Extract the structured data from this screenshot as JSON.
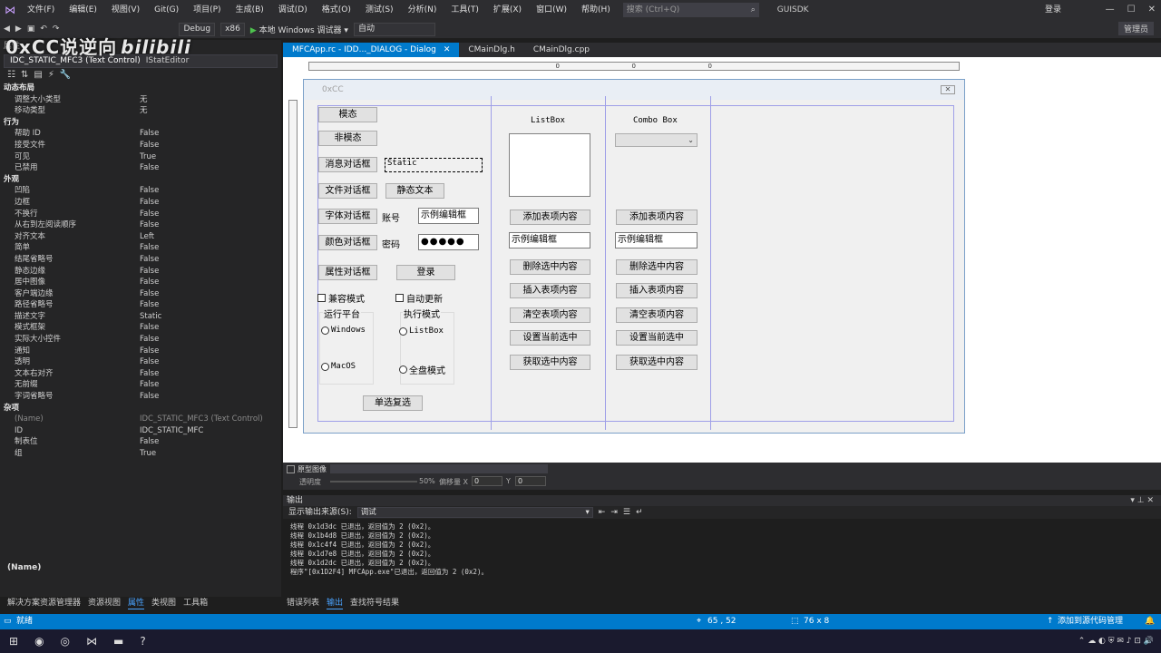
{
  "menubar": {
    "items": [
      "文件(F)",
      "编辑(E)",
      "视图(V)",
      "Git(G)",
      "项目(P)",
      "生成(B)",
      "调试(D)",
      "格式(O)",
      "测试(S)",
      "分析(N)",
      "工具(T)",
      "扩展(X)",
      "窗口(W)",
      "帮助(H)"
    ],
    "search_placeholder": "搜索 (Ctrl+Q)",
    "app_name": "GUISDK",
    "login": "登录",
    "feedback": "管理员"
  },
  "toolbar": {
    "config": "Debug",
    "platform": "x86",
    "run_label": "本地 Windows 调试器",
    "auto": "自动"
  },
  "watermark": {
    "text": "0xCC说逆向",
    "bili": "bilibili"
  },
  "properties": {
    "title": "属性",
    "object": "IDC_STATIC_MFC3 (Text Control)",
    "editor": "IStatEditor",
    "rows": [
      {
        "k": "动态布局",
        "v": "",
        "cat": true
      },
      {
        "k": "调整大小类型",
        "v": "无"
      },
      {
        "k": "移动类型",
        "v": "无"
      },
      {
        "k": "行为",
        "v": "",
        "cat": true
      },
      {
        "k": "帮助 ID",
        "v": "False"
      },
      {
        "k": "接受文件",
        "v": "False"
      },
      {
        "k": "可见",
        "v": "True"
      },
      {
        "k": "已禁用",
        "v": "False"
      },
      {
        "k": "外观",
        "v": "",
        "cat": true
      },
      {
        "k": "凹陷",
        "v": "False"
      },
      {
        "k": "边框",
        "v": "False"
      },
      {
        "k": "不换行",
        "v": "False"
      },
      {
        "k": "从右到左阅读顺序",
        "v": "False"
      },
      {
        "k": "对齐文本",
        "v": "Left"
      },
      {
        "k": "简单",
        "v": "False"
      },
      {
        "k": "结尾省略号",
        "v": "False"
      },
      {
        "k": "静态边缘",
        "v": "False"
      },
      {
        "k": "居中图像",
        "v": "False"
      },
      {
        "k": "客户端边缘",
        "v": "False"
      },
      {
        "k": "路径省略号",
        "v": "False"
      },
      {
        "k": "描述文字",
        "v": "Static"
      },
      {
        "k": "模式框架",
        "v": "False"
      },
      {
        "k": "实际大小控件",
        "v": "False"
      },
      {
        "k": "通知",
        "v": "False"
      },
      {
        "k": "透明",
        "v": "False"
      },
      {
        "k": "文本右对齐",
        "v": "False"
      },
      {
        "k": "无前缀",
        "v": "False"
      },
      {
        "k": "字词省略号",
        "v": "False"
      },
      {
        "k": "杂项",
        "v": "",
        "cat": true
      },
      {
        "k": "(Name)",
        "v": "IDC_STATIC_MFC3 (Text Control)",
        "dim": true
      },
      {
        "k": "ID",
        "v": "IDC_STATIC_MFC"
      },
      {
        "k": "制表位",
        "v": "False"
      },
      {
        "k": "组",
        "v": "True"
      }
    ],
    "description": "(Name)"
  },
  "left_bottom_tabs": [
    "解决方案资源管理器",
    "资源视图",
    "属性",
    "类视图",
    "工具箱"
  ],
  "doc_tabs": [
    "MFCApp.rc - IDD..._DIALOG - Dialog",
    "CMainDlg.h",
    "CMainDlg.cpp"
  ],
  "ruler_marks": [
    "0",
    "0",
    "0"
  ],
  "dialog": {
    "caption": "0xCC",
    "close": "✕",
    "btn_modal": "模态",
    "btn_modeless": "非模态",
    "btn_msgbox": "消息对话框",
    "static_text": "Static",
    "btn_file": "文件对话框",
    "btn_static": "静态文本",
    "btn_font": "字体对话框",
    "lbl_account": "账号",
    "edit_account": "示例编辑框",
    "btn_color": "颜色对话框",
    "lbl_password": "密码",
    "edit_password": "●●●●●",
    "btn_propsheet": "属性对话框",
    "btn_login": "登录",
    "chk_compat": "兼容模式",
    "chk_autoupdate": "自动更新",
    "grp_platform": "运行平台",
    "grp_mode": "执行模式",
    "radio_windows": "Windows",
    "radio_listbox": "ListBox",
    "radio_macos": "MacOS",
    "radio_fulldisk": "全盘模式",
    "btn_radio_check": "单选复选",
    "listbox_label": "ListBox",
    "combo_label": "Combo Box",
    "lb_add": "添加表项内容",
    "lb_edit": "示例编辑框",
    "lb_delete": "删除选中内容",
    "lb_insert": "插入表项内容",
    "lb_clear": "清空表项内容",
    "lb_setsel": "设置当前选中",
    "lb_getsel": "获取选中内容",
    "cb_add": "添加表项内容",
    "cb_edit": "示例编辑框",
    "cb_delete": "删除选中内容",
    "cb_insert": "插入表项内容",
    "cb_clear": "清空表项内容",
    "cb_setsel": "设置当前选中",
    "cb_getsel": "获取选中内容"
  },
  "protobar": {
    "label": "原型图像",
    "opacity": "透明度",
    "pct": "50%",
    "offset": "偏移量 X",
    "x": "0",
    "y_label": "Y",
    "y": "0"
  },
  "output": {
    "title": "输出",
    "source_label": "显示输出来源(S):",
    "source": "调试",
    "lines": [
      "线程 0x1d3dc 已退出，返回值为 2 (0x2)。",
      "线程 0x1b4d8 已退出，返回值为 2 (0x2)。",
      "线程 0x1c4f4 已退出，返回值为 2 (0x2)。",
      "线程 0x1d7e8 已退出，返回值为 2 (0x2)。",
      "线程 0x1d2dc 已退出，返回值为 2 (0x2)。",
      "程序\"[0x1D2F4] MFCApp.exe\"已退出，返回值为 2 (0x2)。"
    ]
  },
  "output_tabs": [
    "错误列表",
    "输出",
    "查找符号结果"
  ],
  "status": {
    "ready": "就绪",
    "pos": "65 , 52",
    "size": "76 x 8",
    "source_control": "添加到源代码管理"
  }
}
